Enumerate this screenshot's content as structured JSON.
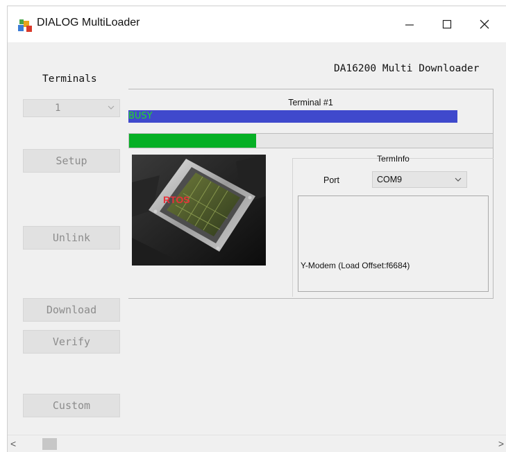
{
  "window": {
    "title": "DIALOG MultiLoader",
    "app_icon": "multiloader-app-icon",
    "controls": {
      "minimize": "—",
      "maximize": "☐",
      "close": "✕"
    }
  },
  "header": {
    "product_title": "DA16200 Multi Downloader"
  },
  "sidebar": {
    "terminals_label": "Terminals",
    "terminal_select": {
      "value": "1",
      "icon": "chevron-down-icon"
    },
    "buttons": {
      "setup": "Setup",
      "unlink": "Unlink",
      "download": "Download",
      "verify": "Verify",
      "custom": "Custom"
    }
  },
  "terminal": {
    "title": "Terminal #1",
    "status": "BUSY",
    "status_color": "#22dd22",
    "status_bar_color": "#3f49cc",
    "progress": 0.35,
    "progress_color": "#06b025",
    "image": {
      "icon": "chip-image",
      "overlay_text": "RTOS"
    },
    "terminfo": {
      "title": "TermInfo",
      "port_label": "Port",
      "port_value": "COM9",
      "log_text": "Y-Modem (Load Offset:f6684)"
    }
  },
  "scrollbar": {
    "left_arrow": "<",
    "right_arrow": ">"
  }
}
